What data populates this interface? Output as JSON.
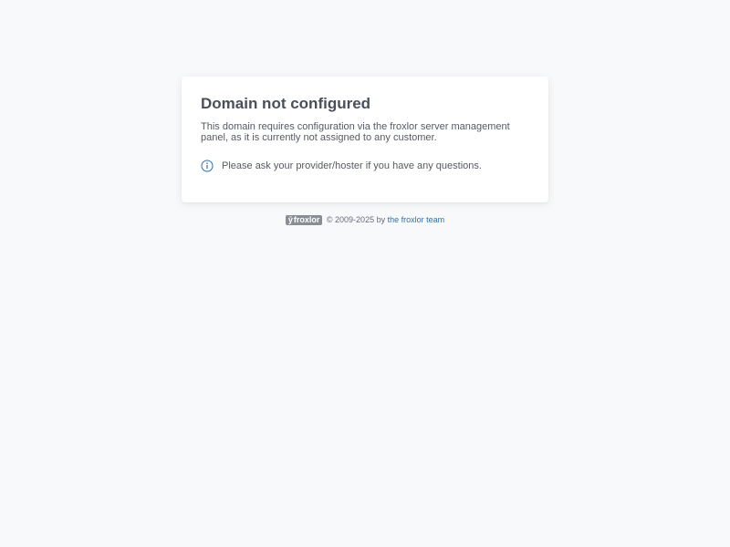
{
  "card": {
    "title": "Domain not configured",
    "description": "This domain requires configuration via the froxlor server management panel, as it is currently not assigned to any customer.",
    "info_text": "Please ask your provider/hoster if you have any questions.",
    "info_icon": "info-circle-icon"
  },
  "footer": {
    "logo_text": "froxlor",
    "copyright": "© 2009-2025 by",
    "link_text": "the froxlor team"
  },
  "colors": {
    "background": "#f8f9fb",
    "link": "#2f6fae",
    "info_icon": "#2f6fae"
  }
}
